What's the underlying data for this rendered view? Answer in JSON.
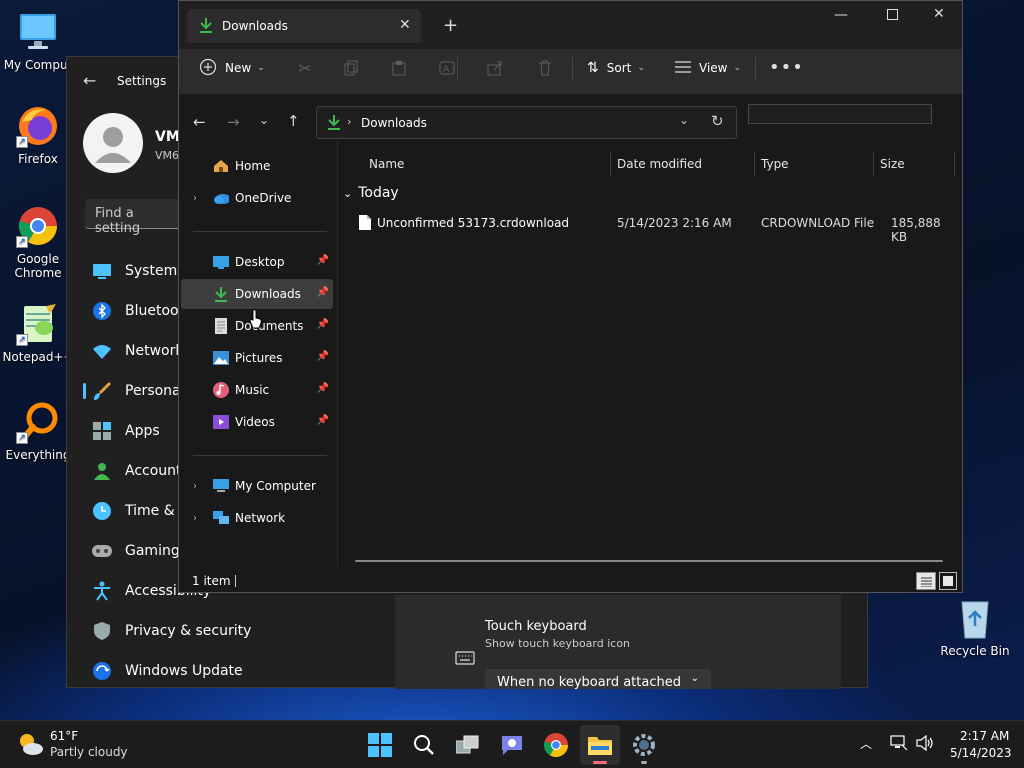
{
  "desktop": {
    "icons": [
      {
        "label": "My Comput"
      },
      {
        "label": "Firefox"
      },
      {
        "label": "Google Chrome"
      },
      {
        "label": "Notepad++"
      },
      {
        "label": "Everything"
      },
      {
        "label": "Recycle Bin"
      }
    ]
  },
  "settings": {
    "title": "Settings",
    "user_name": "VM",
    "user_sub": "VM6",
    "search_placeholder": "Find a setting",
    "nav": [
      {
        "label": "System",
        "icon": "monitor-icon"
      },
      {
        "label": "Bluetoot",
        "icon": "bluetooth-icon"
      },
      {
        "label": "Network",
        "icon": "wifi-icon"
      },
      {
        "label": "Personal",
        "icon": "brush-icon"
      },
      {
        "label": "Apps",
        "icon": "apps-icon"
      },
      {
        "label": "Account",
        "icon": "person-icon"
      },
      {
        "label": "Time &",
        "icon": "clock-icon"
      },
      {
        "label": "Gaming",
        "icon": "gamepad-icon"
      },
      {
        "label": "Accessibility",
        "icon": "accessibility-icon"
      },
      {
        "label": "Privacy & security",
        "icon": "shield-icon"
      },
      {
        "label": "Windows Update",
        "icon": "update-icon"
      }
    ],
    "touch_keyboard": {
      "title": "Touch keyboard",
      "subtitle": "Show touch keyboard icon",
      "dropdown": "When no keyboard attached"
    }
  },
  "explorer": {
    "tab_title": "Downloads",
    "toolbar": {
      "new_label": "New",
      "sort_label": "Sort",
      "view_label": "View"
    },
    "address": {
      "location": "Downloads"
    },
    "sidebar": {
      "home": "Home",
      "onedrive": "OneDrive",
      "pinned": [
        {
          "label": "Desktop",
          "icon": "desktop-icon"
        },
        {
          "label": "Downloads",
          "icon": "download-icon"
        },
        {
          "label": "Documents",
          "icon": "document-icon"
        },
        {
          "label": "Pictures",
          "icon": "pictures-icon"
        },
        {
          "label": "Music",
          "icon": "music-icon"
        },
        {
          "label": "Videos",
          "icon": "videos-icon"
        }
      ],
      "my_computer": "My Computer",
      "network": "Network"
    },
    "columns": {
      "name": "Name",
      "date": "Date modified",
      "type": "Type",
      "size": "Size"
    },
    "group_label": "Today",
    "files": [
      {
        "name": "Unconfirmed 53173.crdownload",
        "date": "5/14/2023 2:16 AM",
        "type": "CRDOWNLOAD File",
        "size": "185,888 KB"
      }
    ],
    "status": "1 item"
  },
  "taskbar": {
    "weather_temp": "61°F",
    "weather_desc": "Partly cloudy",
    "time": "2:17 AM",
    "date": "5/14/2023"
  },
  "colors": {
    "accent": "#4cc2ff",
    "selected": "#3d3d3d",
    "download_green": "#3fb950",
    "folder_yellow": "#f3c343"
  }
}
